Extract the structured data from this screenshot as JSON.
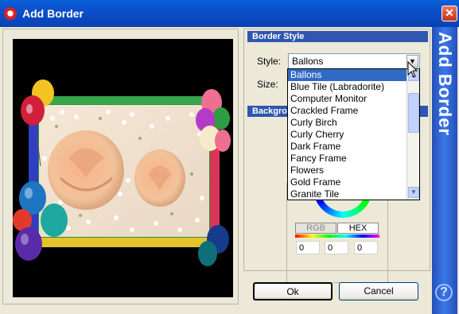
{
  "window": {
    "title": "Add Border",
    "close_glyph": "✕"
  },
  "border_style": {
    "section_title": "Border Style",
    "style_label": "Style:",
    "size_label": "Size:",
    "selected_style": "Ballons",
    "dropdown_arrow": "▼",
    "options": [
      "Ballons",
      "Blue Tile (Labradorite)",
      "Computer Monitor",
      "Crackled Frame",
      "Curly Birch",
      "Curly Cherry",
      "Dark Frame",
      "Fancy Frame",
      "Flowers",
      "Gold Frame",
      "Granite Tile"
    ]
  },
  "background": {
    "section_title_visible": "Backgro",
    "tabs": [
      "RGB",
      "HEX"
    ],
    "values": [
      "0",
      "0",
      "0"
    ]
  },
  "buttons": {
    "ok": "Ok",
    "cancel": "Cancel"
  },
  "side_banner": {
    "text": "Add Border",
    "help_glyph": "?"
  },
  "icons": {
    "app": "app-logo-icon",
    "close": "close-icon",
    "help": "help-icon",
    "dropdown": "chevron-down-icon",
    "cursor": "mouse-pointer-icon"
  },
  "colors": {
    "title_bar": "#0b4fc9",
    "section_header": "#2f56b0",
    "selection": "#316ac5",
    "banner": "#3b78e7"
  }
}
